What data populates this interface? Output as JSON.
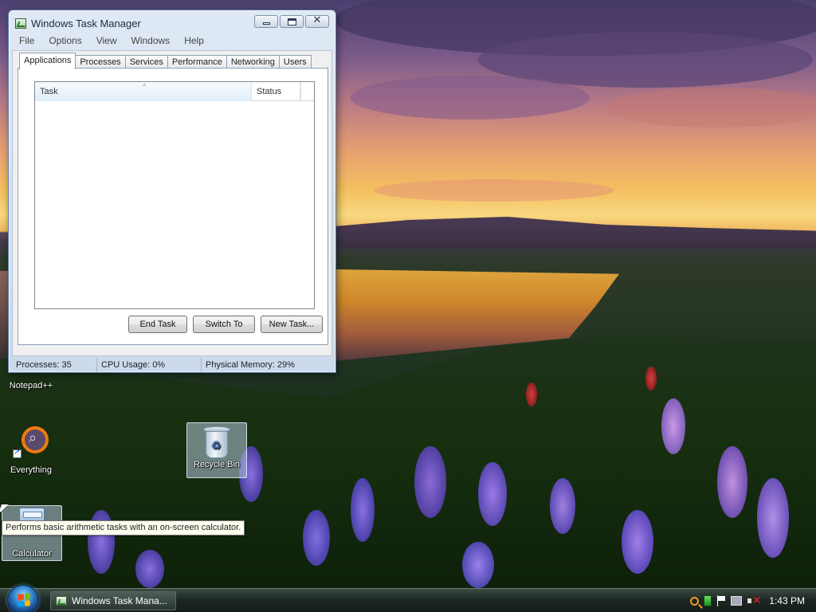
{
  "window": {
    "title": "Windows Task Manager",
    "menu": [
      "File",
      "Options",
      "View",
      "Windows",
      "Help"
    ],
    "tabs": [
      "Applications",
      "Processes",
      "Services",
      "Performance",
      "Networking",
      "Users"
    ],
    "active_tab": "Applications",
    "columns": [
      "Task",
      "Status"
    ],
    "buttons": {
      "end_task": "End Task",
      "switch_to": "Switch To",
      "new_task": "New Task..."
    },
    "status": {
      "processes": "Processes: 35",
      "cpu": "CPU Usage: 0%",
      "memory": "Physical Memory: 29%"
    }
  },
  "desktop_icons": {
    "notepadpp": "Notepad++",
    "everything": "Everything",
    "recycle_bin": "Recycle Bin",
    "calculator": "Calculator"
  },
  "tooltip": "Performs basic arithmetic tasks with an on-screen calculator.",
  "taskbar": {
    "task_button": "Windows Task Mana...",
    "clock": "1:43 PM"
  },
  "icons": [
    "task-manager-icon",
    "minimize-icon",
    "maximize-icon",
    "close-icon",
    "sort-arrow-icon",
    "recycle-bin-icon",
    "everything-icon",
    "calculator-icon",
    "shortcut-arrow-icon",
    "start-orb-icon",
    "search-tray-icon",
    "green-tray-icon",
    "flag-tray-icon",
    "network-tray-icon",
    "volume-muted-icon"
  ]
}
